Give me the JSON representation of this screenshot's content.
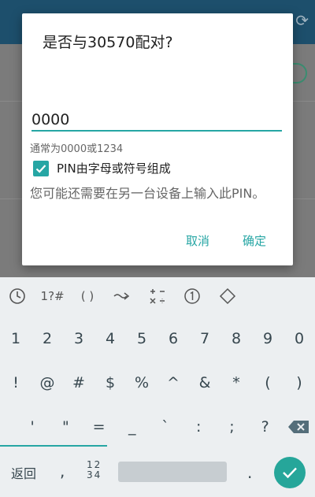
{
  "dialog": {
    "title": "是否与30570配对?",
    "pin_value": "0000",
    "hint": "通常为0000或1234",
    "checkbox_label": "PIN由字母或符号组成",
    "checkbox_checked": true,
    "description": "您可能还需要在另一台设备上输入此PIN。",
    "cancel_label": "取消",
    "ok_label": "确定",
    "accent_color": "#26a6a4"
  },
  "keyboard": {
    "toolbar": {
      "numbers_label": "1?#",
      "brackets_label": "( )"
    },
    "rows": [
      [
        "1",
        "2",
        "3",
        "4",
        "5",
        "6",
        "7",
        "8",
        "9",
        "0"
      ],
      [
        "!",
        "@",
        "#",
        "$",
        "%",
        "^",
        "&",
        "*",
        "(",
        ")"
      ],
      [
        "'",
        "\"",
        "=",
        "_",
        "`",
        ":",
        ";",
        "?"
      ]
    ],
    "back_label": "返回",
    "comma_label": ",",
    "numswitch_top": "12",
    "numswitch_bottom": "34",
    "period_label": ".",
    "enter_color": "#26a69a"
  }
}
